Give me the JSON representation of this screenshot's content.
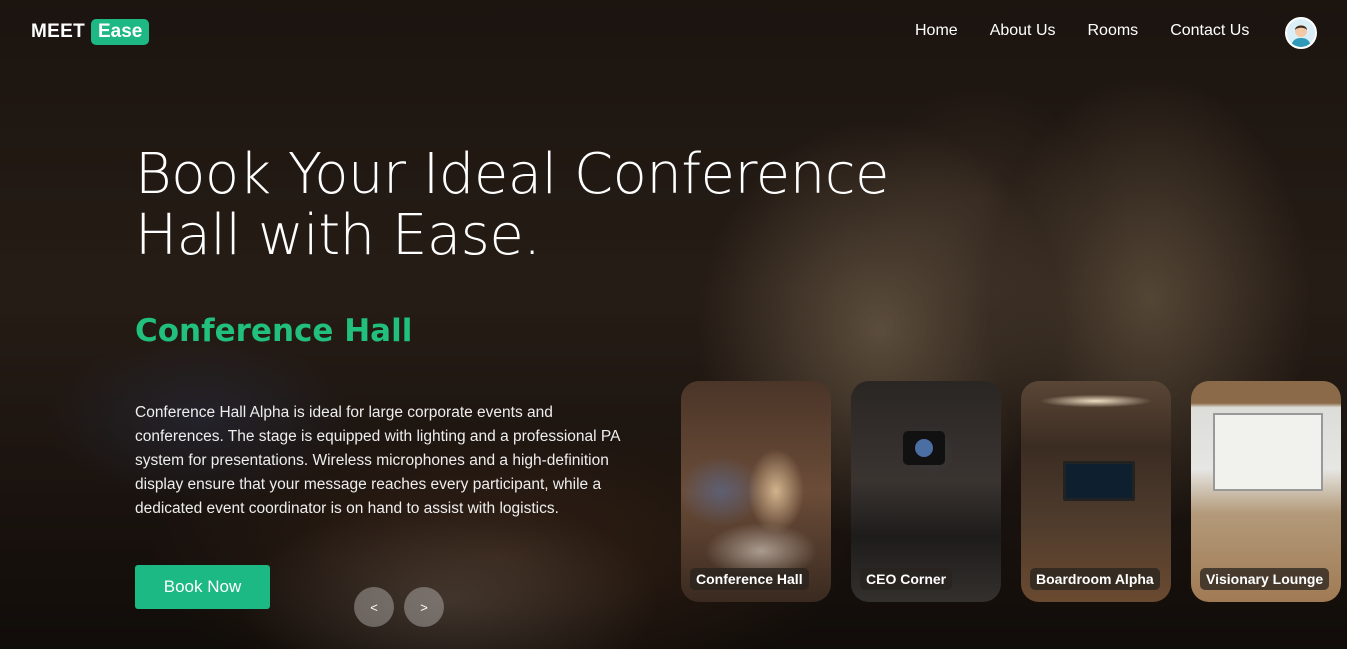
{
  "brand": {
    "name_part1": "MEET",
    "name_part2": "Ease"
  },
  "nav": {
    "links": [
      "Home",
      "About Us",
      "Rooms",
      "Contact Us"
    ]
  },
  "hero": {
    "title": "Book Your Ideal Conference Hall with Ease.",
    "room_name": "Conference Hall",
    "room_description": "Conference Hall Alpha is ideal for large corporate events and conferences. The stage is equipped with lighting and a professional PA system for presentations. Wireless microphones and a high-definition display ensure that your message reaches every participant, while a dedicated event coordinator is on hand to assist with logistics.",
    "book_button": "Book Now"
  },
  "carousel": {
    "prev_label": "<",
    "next_label": ">"
  },
  "rooms": [
    {
      "label": "Conference Hall"
    },
    {
      "label": "CEO Corner"
    },
    {
      "label": "Boardroom Alpha"
    },
    {
      "label": "Visionary Lounge"
    }
  ],
  "colors": {
    "accent": "#1db884",
    "room_title": "#22c07d"
  }
}
